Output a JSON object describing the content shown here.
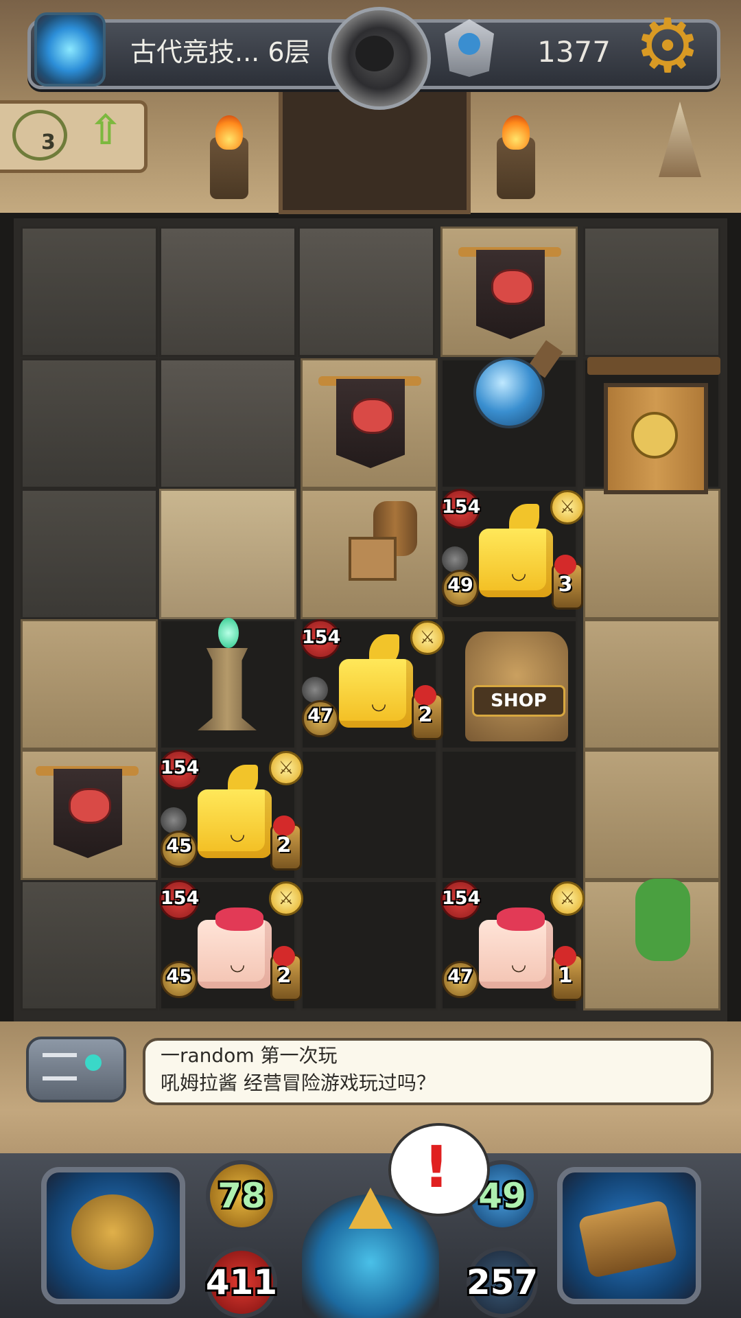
{
  "header": {
    "location": "古代竞技... 6层",
    "gold": "1377"
  },
  "floor_card": {
    "stairs_count": "3"
  },
  "board": {
    "monsters": [
      {
        "id": "yellow-cube-1",
        "hp": "154",
        "attack": "49",
        "level": "3",
        "type": "yellow-cube"
      },
      {
        "id": "yellow-cube-2",
        "hp": "154",
        "attack": "47",
        "level": "2",
        "type": "yellow-cube"
      },
      {
        "id": "yellow-cube-3",
        "hp": "154",
        "attack": "45",
        "level": "2",
        "type": "yellow-cube"
      },
      {
        "id": "pink-cube-1",
        "hp": "154",
        "attack": "45",
        "level": "2",
        "type": "pink-cube"
      },
      {
        "id": "pink-cube-2",
        "hp": "154",
        "attack": "47",
        "level": "1",
        "type": "pink-cube"
      }
    ],
    "shop_label": "SHOP",
    "monster_face": "◡"
  },
  "chat": {
    "line1": "一random  第一次玩",
    "line2": "吼姆拉酱  经营冒险游戏玩过吗？"
  },
  "hud": {
    "attack": "78",
    "hp": "411",
    "defense": "49",
    "mana": "257",
    "alert": "!",
    "colors": {
      "attack_orb": "#c8921e",
      "hp_orb": "#c0201c",
      "defense_orb": "#2a6ea8",
      "mana_orb": "#24384e"
    }
  },
  "icons": {
    "gear": "⚙",
    "up_arrow": "⇧",
    "sword": "⚔"
  }
}
